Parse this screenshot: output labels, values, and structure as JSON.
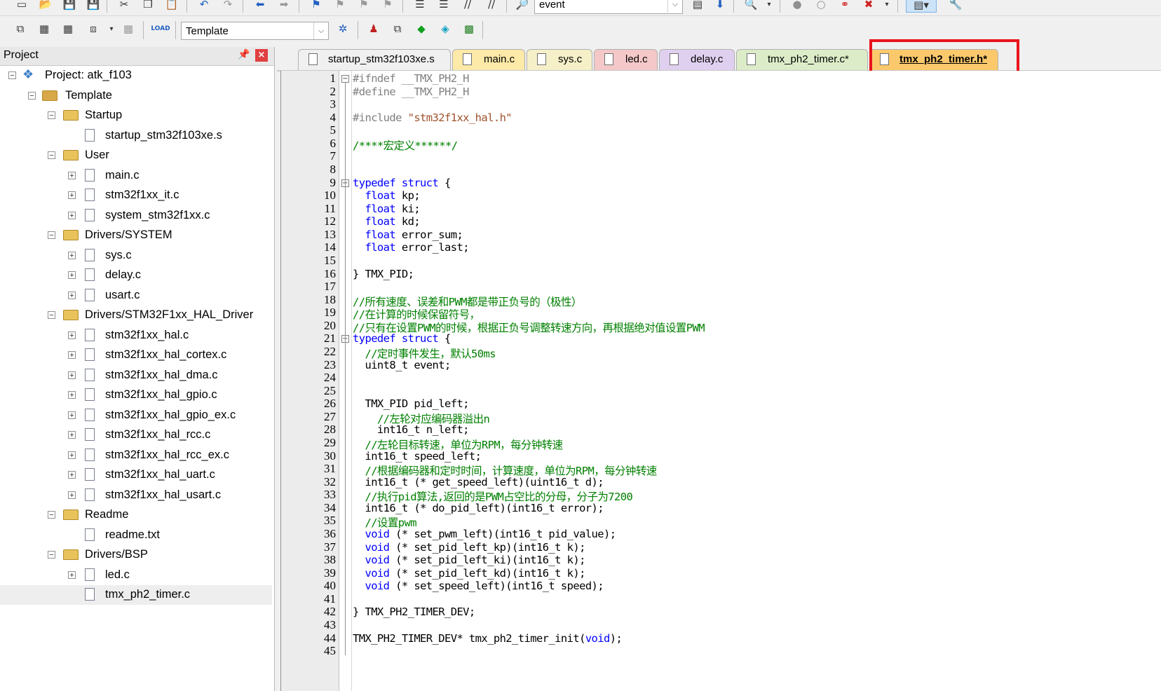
{
  "toolbar": {
    "target_dropdown": "event",
    "build_target": "Template"
  },
  "project_panel": {
    "title": "Project",
    "tree": [
      {
        "label": "Project: atk_f103",
        "kind": "project",
        "level": 0,
        "expander": "−"
      },
      {
        "label": "Template",
        "kind": "target",
        "level": 1,
        "expander": "−"
      },
      {
        "label": "Startup",
        "kind": "folder",
        "level": 2,
        "expander": "−"
      },
      {
        "label": "startup_stm32f103xe.s",
        "kind": "file",
        "level": 3,
        "expander": ""
      },
      {
        "label": "User",
        "kind": "folder",
        "level": 2,
        "expander": "−"
      },
      {
        "label": "main.c",
        "kind": "file",
        "level": 3,
        "expander": "+"
      },
      {
        "label": "stm32f1xx_it.c",
        "kind": "file",
        "level": 3,
        "expander": "+"
      },
      {
        "label": "system_stm32f1xx.c",
        "kind": "file",
        "level": 3,
        "expander": "+"
      },
      {
        "label": "Drivers/SYSTEM",
        "kind": "folder",
        "level": 2,
        "expander": "−"
      },
      {
        "label": "sys.c",
        "kind": "file",
        "level": 3,
        "expander": "+"
      },
      {
        "label": "delay.c",
        "kind": "file",
        "level": 3,
        "expander": "+"
      },
      {
        "label": "usart.c",
        "kind": "file",
        "level": 3,
        "expander": "+"
      },
      {
        "label": "Drivers/STM32F1xx_HAL_Driver",
        "kind": "folder",
        "level": 2,
        "expander": "−"
      },
      {
        "label": "stm32f1xx_hal.c",
        "kind": "file",
        "level": 3,
        "expander": "+"
      },
      {
        "label": "stm32f1xx_hal_cortex.c",
        "kind": "file",
        "level": 3,
        "expander": "+"
      },
      {
        "label": "stm32f1xx_hal_dma.c",
        "kind": "file",
        "level": 3,
        "expander": "+"
      },
      {
        "label": "stm32f1xx_hal_gpio.c",
        "kind": "file",
        "level": 3,
        "expander": "+"
      },
      {
        "label": "stm32f1xx_hal_gpio_ex.c",
        "kind": "file",
        "level": 3,
        "expander": "+"
      },
      {
        "label": "stm32f1xx_hal_rcc.c",
        "kind": "file",
        "level": 3,
        "expander": "+"
      },
      {
        "label": "stm32f1xx_hal_rcc_ex.c",
        "kind": "file",
        "level": 3,
        "expander": "+"
      },
      {
        "label": "stm32f1xx_hal_uart.c",
        "kind": "file",
        "level": 3,
        "expander": "+"
      },
      {
        "label": "stm32f1xx_hal_usart.c",
        "kind": "file",
        "level": 3,
        "expander": "+"
      },
      {
        "label": "Readme",
        "kind": "folder",
        "level": 2,
        "expander": "−"
      },
      {
        "label": "readme.txt",
        "kind": "file",
        "level": 3,
        "expander": ""
      },
      {
        "label": "Drivers/BSP",
        "kind": "folder",
        "level": 2,
        "expander": "−"
      },
      {
        "label": "led.c",
        "kind": "file",
        "level": 3,
        "expander": "+"
      },
      {
        "label": "tmx_ph2_timer.c",
        "kind": "file",
        "level": 3,
        "expander": "",
        "selected": true
      }
    ]
  },
  "tabs": [
    {
      "label": "startup_stm32f103xe.s",
      "color": "#f0f0f0",
      "active": false
    },
    {
      "label": "main.c",
      "color": "#fde9a8",
      "active": false
    },
    {
      "label": "sys.c",
      "color": "#f5f0c8",
      "active": false
    },
    {
      "label": "led.c",
      "color": "#f4c8c8",
      "active": false
    },
    {
      "label": "delay.c",
      "color": "#e0d0f0",
      "active": false
    },
    {
      "label": "tmx_ph2_timer.c*",
      "color": "#dcecc8",
      "active": false
    },
    {
      "label": "tmx_ph2_timer.h*",
      "color": "#fbc96c",
      "active": true
    }
  ],
  "editor": {
    "lines": [
      [
        [
          "pp",
          "#ifndef __TMX_PH2_H"
        ]
      ],
      [
        [
          "pp",
          "#define __TMX_PH2_H"
        ]
      ],
      [],
      [
        [
          "pp",
          "#include "
        ],
        [
          "str",
          "\"stm32f1xx_hal.h\""
        ]
      ],
      [],
      [
        [
          "cm",
          "/****宏定义******/"
        ]
      ],
      [],
      [],
      [
        [
          "kw",
          "typedef"
        ],
        [
          "t",
          " "
        ],
        [
          "kw",
          "struct"
        ],
        [
          "t",
          " {"
        ]
      ],
      [
        [
          "t",
          "  "
        ],
        [
          "kw",
          "float"
        ],
        [
          "t",
          " kp;"
        ]
      ],
      [
        [
          "t",
          "  "
        ],
        [
          "kw",
          "float"
        ],
        [
          "t",
          " ki;"
        ]
      ],
      [
        [
          "t",
          "  "
        ],
        [
          "kw",
          "float"
        ],
        [
          "t",
          " kd;"
        ]
      ],
      [
        [
          "t",
          "  "
        ],
        [
          "kw",
          "float"
        ],
        [
          "t",
          " error_sum;"
        ]
      ],
      [
        [
          "t",
          "  "
        ],
        [
          "kw",
          "float"
        ],
        [
          "t",
          " error_last;"
        ]
      ],
      [],
      [
        [
          "t",
          "} TMX_PID;"
        ]
      ],
      [],
      [
        [
          "cm",
          "//所有速度、误差和PWM都是带正负号的（极性）"
        ]
      ],
      [
        [
          "cm",
          "//在计算的时候保留符号，"
        ]
      ],
      [
        [
          "cm",
          "//只有在设置PWM的时候，根据正负号调整转速方向，再根据绝对值设置PWM"
        ]
      ],
      [
        [
          "kw",
          "typedef"
        ],
        [
          "t",
          " "
        ],
        [
          "kw",
          "struct"
        ],
        [
          "t",
          " {"
        ]
      ],
      [
        [
          "t",
          "  "
        ],
        [
          "cm",
          "//定时事件发生，默认50ms"
        ]
      ],
      [
        [
          "t",
          "  uint8_t event;"
        ]
      ],
      [],
      [],
      [
        [
          "t",
          "  TMX_PID pid_left;"
        ]
      ],
      [
        [
          "t",
          "    "
        ],
        [
          "cm",
          "//左轮对应编码器溢出n"
        ]
      ],
      [
        [
          "t",
          "    int16_t n_left;"
        ]
      ],
      [
        [
          "t",
          "  "
        ],
        [
          "cm",
          "//左轮目标转速，单位为RPM，每分钟转速"
        ]
      ],
      [
        [
          "t",
          "  int16_t speed_left;"
        ]
      ],
      [
        [
          "t",
          "  "
        ],
        [
          "cm",
          "//根据编码器和定时时间，计算速度，单位为RPM，每分钟转速"
        ]
      ],
      [
        [
          "t",
          "  int16_t (* get_speed_left)(uint16_t d);"
        ]
      ],
      [
        [
          "t",
          "  "
        ],
        [
          "cm",
          "//执行pid算法,返回的是PWM占空比的分母，分子为7200"
        ]
      ],
      [
        [
          "t",
          "  int16_t (* do_pid_left)(int16_t error);"
        ]
      ],
      [
        [
          "t",
          "  "
        ],
        [
          "cm",
          "//设置pwm"
        ]
      ],
      [
        [
          "t",
          "  "
        ],
        [
          "kw",
          "void"
        ],
        [
          "t",
          " (* set_pwm_left)(int16_t pid_value);"
        ]
      ],
      [
        [
          "t",
          "  "
        ],
        [
          "kw",
          "void"
        ],
        [
          "t",
          " (* set_pid_left_kp)(int16_t k);"
        ]
      ],
      [
        [
          "t",
          "  "
        ],
        [
          "kw",
          "void"
        ],
        [
          "t",
          " (* set_pid_left_ki)(int16_t k);"
        ]
      ],
      [
        [
          "t",
          "  "
        ],
        [
          "kw",
          "void"
        ],
        [
          "t",
          " (* set_pid_left_kd)(int16_t k);"
        ]
      ],
      [
        [
          "t",
          "  "
        ],
        [
          "kw",
          "void"
        ],
        [
          "t",
          " (* set_speed_left)(int16_t speed);"
        ]
      ],
      [],
      [
        [
          "t",
          "} TMX_PH2_TIMER_DEV;"
        ]
      ],
      [],
      [
        [
          "t",
          "TMX_PH2_TIMER_DEV* tmx_ph2_timer_init("
        ],
        [
          "kw",
          "void"
        ],
        [
          "t",
          ");"
        ]
      ],
      []
    ]
  }
}
